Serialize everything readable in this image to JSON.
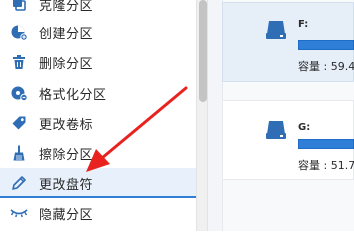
{
  "sidebar": {
    "items": [
      {
        "label": "克隆分区",
        "icon": "clone-icon"
      },
      {
        "label": "创建分区",
        "icon": "create-partition-icon"
      },
      {
        "label": "删除分区",
        "icon": "trash-icon"
      },
      {
        "label": "格式化分区",
        "icon": "format-icon"
      },
      {
        "label": "更改卷标",
        "icon": "tag-icon"
      },
      {
        "label": "擦除分区",
        "icon": "broom-icon"
      },
      {
        "label": "更改盘符",
        "icon": "pencil-icon",
        "selected": true
      },
      {
        "label": "隐藏分区",
        "icon": "eye-closed-icon"
      }
    ]
  },
  "drives": [
    {
      "letter": "F:",
      "capacity": "容量 : 59.4",
      "selected": true
    },
    {
      "letter": "G:",
      "capacity": "容量 : 51.7",
      "selected": false
    }
  ],
  "colors": {
    "accent": "#2f7fd9",
    "icon": "#2f6db5",
    "arrow": "#e8231f",
    "selected_bg": "#e8f1fb"
  }
}
